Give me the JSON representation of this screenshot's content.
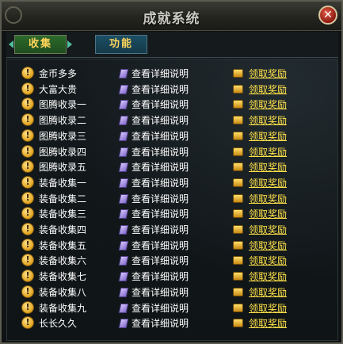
{
  "window": {
    "title": "成就系统",
    "close_icon": "✕"
  },
  "tabs": [
    {
      "label": "收集",
      "color": "#2d6a2c"
    },
    {
      "label": "功能",
      "color": "#1c4e64"
    }
  ],
  "row_badge": "!",
  "rows": [
    {
      "name": "金币多多",
      "detail": "查看详细说明",
      "reward": "领取奖励"
    },
    {
      "name": "大富大贵",
      "detail": "查看详细说明",
      "reward": "领取奖励"
    },
    {
      "name": "图腾收录一",
      "detail": "查看详细说明",
      "reward": "领取奖励"
    },
    {
      "name": "图腾收录二",
      "detail": "查看详细说明",
      "reward": "领取奖励"
    },
    {
      "name": "图腾收录三",
      "detail": "查看详细说明",
      "reward": "领取奖励"
    },
    {
      "name": "图腾收录四",
      "detail": "查看详细说明",
      "reward": "领取奖励"
    },
    {
      "name": "图腾收录五",
      "detail": "查看详细说明",
      "reward": "领取奖励"
    },
    {
      "name": "装备收集一",
      "detail": "查看详细说明",
      "reward": "领取奖励"
    },
    {
      "name": "装备收集二",
      "detail": "查看详细说明",
      "reward": "领取奖励"
    },
    {
      "name": "装备收集三",
      "detail": "查看详细说明",
      "reward": "领取奖励"
    },
    {
      "name": "装备收集四",
      "detail": "查看详细说明",
      "reward": "领取奖励"
    },
    {
      "name": "装备收集五",
      "detail": "查看详细说明",
      "reward": "领取奖励"
    },
    {
      "name": "装备收集六",
      "detail": "查看详细说明",
      "reward": "领取奖励"
    },
    {
      "name": "装备收集七",
      "detail": "查看详细说明",
      "reward": "领取奖励"
    },
    {
      "name": "装备收集八",
      "detail": "查看详细说明",
      "reward": "领取奖励"
    },
    {
      "name": "装备收集九",
      "detail": "查看详细说明",
      "reward": "领取奖励"
    },
    {
      "name": "长长久久",
      "detail": "查看详细说明",
      "reward": "领取奖励"
    }
  ],
  "icons": {
    "badge": "warning-badge-icon",
    "detail": "scroll-icon",
    "reward": "treasure-chest-icon"
  },
  "colors": {
    "reward_link": "#ffe24a",
    "text": "#ffffff",
    "tab_text": "#ffd45a"
  }
}
